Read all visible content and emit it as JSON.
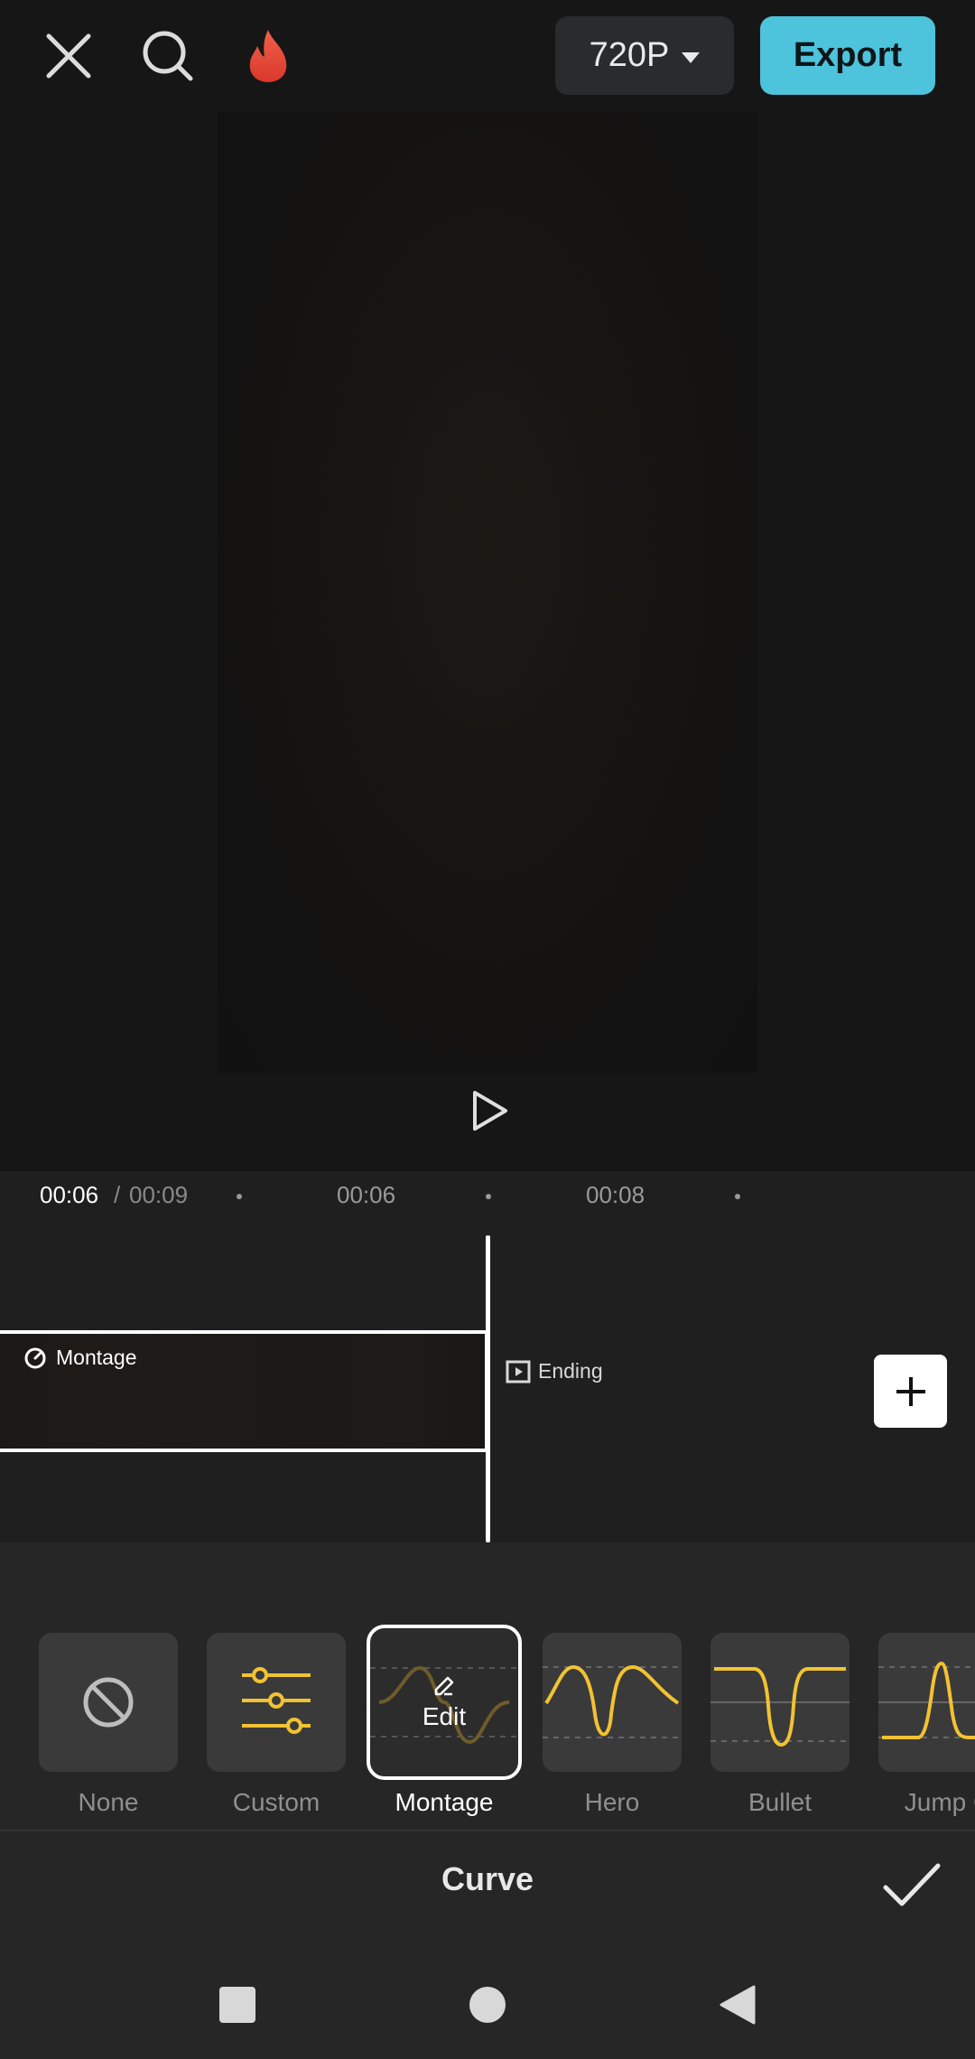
{
  "topbar": {
    "resolution": "720P",
    "export_label": "Export"
  },
  "timeline": {
    "current_time": "00:06",
    "separator": "/",
    "total_time": "00:09",
    "ticks": [
      "00:06",
      "00:08"
    ],
    "clip_label": "Montage",
    "ending_label": "Ending"
  },
  "curves": {
    "items": [
      {
        "label": "None"
      },
      {
        "label": "Custom"
      },
      {
        "label": "Montage",
        "edit_label": "Edit"
      },
      {
        "label": "Hero"
      },
      {
        "label": "Bullet"
      },
      {
        "label": "Jump C"
      }
    ],
    "selected": "Montage",
    "panel_title": "Curve"
  },
  "colors": {
    "accent": "#4dc3dc",
    "curve_yellow": "#f1c232",
    "background": "#161616"
  }
}
